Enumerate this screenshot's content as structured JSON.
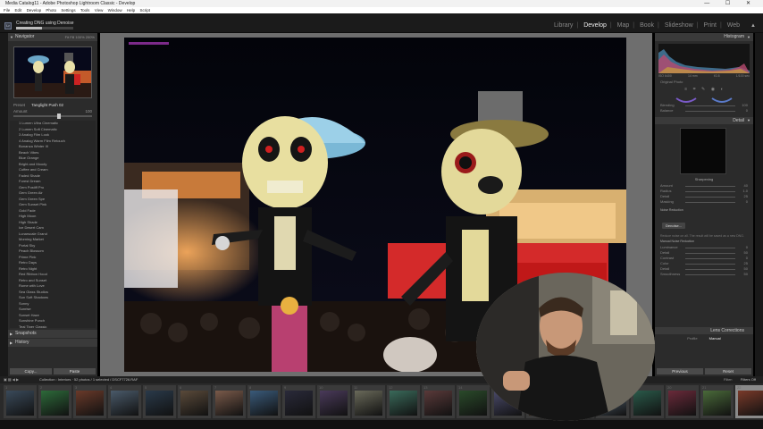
{
  "window": {
    "title": "Media Catalog11 - Adobe Photoshop Lightroom Classic - Develop",
    "controls": "— ☐ ✕"
  },
  "menu": [
    "File",
    "Edit",
    "Develop",
    "Photo",
    "Settings",
    "Tools",
    "View",
    "Window",
    "Help",
    "Script"
  ],
  "identity_plate": {
    "logo": "Lr",
    "progress_text": "Creating DNG using Denoise",
    "progress": 0.45
  },
  "modules": [
    "Library",
    "Develop",
    "Map",
    "Book",
    "Slideshow",
    "Print",
    "Web"
  ],
  "active_module": "Develop",
  "left_panel": {
    "navigator_label": "Navigator",
    "navigator_options": "Fit  Fill  100%  200%",
    "preset_label": "Preset",
    "preset_value": "Tanglight Push 02",
    "amount_label": "Amount",
    "amount_value": "100",
    "presets": [
      "1 Lumen Ultra Cinematic",
      "2 Lumen Soft Cinematic",
      "3 Analog Film Look",
      "4 Analog Warm Film Retouch",
      "Bonanza Winter III",
      "Beach Vibes",
      "Blue Orange",
      "Bright and Moody",
      "Coffee and Cream",
      "Faded Shade",
      "Forest Dream",
      "Gem Postiff Pro",
      "Gem Green Air",
      "Gem Green Spe",
      "Gem Sunset Pink",
      "Gold Fade",
      "High Moon",
      "High Shade",
      "Ice Desert Cam",
      "Lunarscale Grand",
      "Morning Market",
      "Portal Sky",
      "Peach Blossom",
      "Prime Pink",
      "Retro Days",
      "Retro Night",
      "Red Ribbon Hood",
      "Retro and Sunset",
      "Rome with Love",
      "Sea Glass Studios",
      "Sun Soft Shadows",
      "Sunny",
      "Sunrise",
      "Sunset Haze",
      "Sunshine Punch",
      "Teal Tiger Classic",
      "Tanglight Push 02",
      "Urban Gold",
      "Velvetopia"
    ],
    "selected_preset": "Tanglight Push 02",
    "snapshots_label": "Snapshots",
    "history_label": "History",
    "copy_button": "Copy...",
    "paste_button": "Paste"
  },
  "right_panel": {
    "histogram_label": "Histogram",
    "cam_info": [
      "ISO 6400",
      "14 mm",
      "f/2.8",
      "1/100 sec"
    ],
    "original_photo": "Original Photo",
    "hsl_rows": [
      {
        "label": "Blending",
        "value": "100"
      },
      {
        "label": "Balance",
        "value": "0"
      }
    ],
    "detail_label": "Detail",
    "sharpening_label": "Sharpening",
    "sharpening_rows": [
      {
        "label": "Amount",
        "value": "40"
      },
      {
        "label": "Radius",
        "value": "1.0"
      },
      {
        "label": "Detail",
        "value": "25"
      },
      {
        "label": "Masking",
        "value": "0"
      }
    ],
    "noise_label": "Noise Reduction",
    "denoise_button": "Denoise...",
    "denoise_note": "Reduce noise on all. The result will be saved as a new DNG.",
    "manual_nr_label": "Manual Noise Reduction",
    "nr_rows": [
      {
        "label": "Luminance",
        "value": "0"
      },
      {
        "label": "Detail",
        "value": "50"
      },
      {
        "label": "Contrast",
        "value": "0"
      },
      {
        "label": "Color",
        "value": "25"
      },
      {
        "label": "Detail",
        "value": "50"
      },
      {
        "label": "Smoothness",
        "value": "50"
      }
    ],
    "lens_label": "Lens Corrections",
    "lens_tabs": [
      "Profile",
      "Manual"
    ],
    "previous_button": "Previous",
    "reset_button": "Reset"
  },
  "filmstrip": {
    "source_label": "Collection : Interiors",
    "count_text": "52 photos / 1 selected / DSCF7726.RAF",
    "filter_label": "Filter:",
    "filter_value": "Filters Off",
    "numbers": [
      "1",
      "2",
      "3",
      "4",
      "5",
      "6",
      "7",
      "8",
      "9",
      "10",
      "11",
      "12",
      "13",
      "14",
      "15",
      "16",
      "17",
      "18",
      "19",
      "20",
      "21",
      "22"
    ]
  },
  "colors": {
    "accent_selected": "#d9d9d9",
    "panel_bg": "#2b2b2b",
    "header_bg": "#3a3a3a"
  }
}
